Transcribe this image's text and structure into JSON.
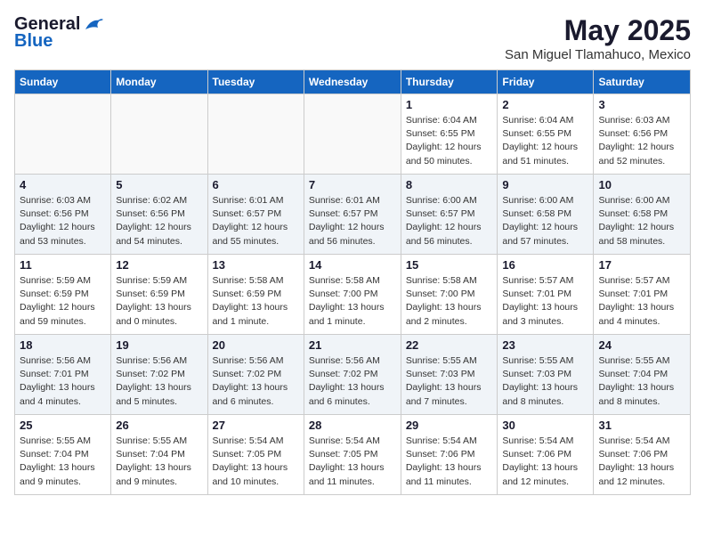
{
  "header": {
    "logo_general": "General",
    "logo_blue": "Blue",
    "month": "May 2025",
    "location": "San Miguel Tlamahuco, Mexico"
  },
  "weekdays": [
    "Sunday",
    "Monday",
    "Tuesday",
    "Wednesday",
    "Thursday",
    "Friday",
    "Saturday"
  ],
  "weeks": [
    [
      {
        "day": "",
        "detail": ""
      },
      {
        "day": "",
        "detail": ""
      },
      {
        "day": "",
        "detail": ""
      },
      {
        "day": "",
        "detail": ""
      },
      {
        "day": "1",
        "detail": "Sunrise: 6:04 AM\nSunset: 6:55 PM\nDaylight: 12 hours\nand 50 minutes."
      },
      {
        "day": "2",
        "detail": "Sunrise: 6:04 AM\nSunset: 6:55 PM\nDaylight: 12 hours\nand 51 minutes."
      },
      {
        "day": "3",
        "detail": "Sunrise: 6:03 AM\nSunset: 6:56 PM\nDaylight: 12 hours\nand 52 minutes."
      }
    ],
    [
      {
        "day": "4",
        "detail": "Sunrise: 6:03 AM\nSunset: 6:56 PM\nDaylight: 12 hours\nand 53 minutes."
      },
      {
        "day": "5",
        "detail": "Sunrise: 6:02 AM\nSunset: 6:56 PM\nDaylight: 12 hours\nand 54 minutes."
      },
      {
        "day": "6",
        "detail": "Sunrise: 6:01 AM\nSunset: 6:57 PM\nDaylight: 12 hours\nand 55 minutes."
      },
      {
        "day": "7",
        "detail": "Sunrise: 6:01 AM\nSunset: 6:57 PM\nDaylight: 12 hours\nand 56 minutes."
      },
      {
        "day": "8",
        "detail": "Sunrise: 6:00 AM\nSunset: 6:57 PM\nDaylight: 12 hours\nand 56 minutes."
      },
      {
        "day": "9",
        "detail": "Sunrise: 6:00 AM\nSunset: 6:58 PM\nDaylight: 12 hours\nand 57 minutes."
      },
      {
        "day": "10",
        "detail": "Sunrise: 6:00 AM\nSunset: 6:58 PM\nDaylight: 12 hours\nand 58 minutes."
      }
    ],
    [
      {
        "day": "11",
        "detail": "Sunrise: 5:59 AM\nSunset: 6:59 PM\nDaylight: 12 hours\nand 59 minutes."
      },
      {
        "day": "12",
        "detail": "Sunrise: 5:59 AM\nSunset: 6:59 PM\nDaylight: 13 hours\nand 0 minutes."
      },
      {
        "day": "13",
        "detail": "Sunrise: 5:58 AM\nSunset: 6:59 PM\nDaylight: 13 hours\nand 1 minute."
      },
      {
        "day": "14",
        "detail": "Sunrise: 5:58 AM\nSunset: 7:00 PM\nDaylight: 13 hours\nand 1 minute."
      },
      {
        "day": "15",
        "detail": "Sunrise: 5:58 AM\nSunset: 7:00 PM\nDaylight: 13 hours\nand 2 minutes."
      },
      {
        "day": "16",
        "detail": "Sunrise: 5:57 AM\nSunset: 7:01 PM\nDaylight: 13 hours\nand 3 minutes."
      },
      {
        "day": "17",
        "detail": "Sunrise: 5:57 AM\nSunset: 7:01 PM\nDaylight: 13 hours\nand 4 minutes."
      }
    ],
    [
      {
        "day": "18",
        "detail": "Sunrise: 5:56 AM\nSunset: 7:01 PM\nDaylight: 13 hours\nand 4 minutes."
      },
      {
        "day": "19",
        "detail": "Sunrise: 5:56 AM\nSunset: 7:02 PM\nDaylight: 13 hours\nand 5 minutes."
      },
      {
        "day": "20",
        "detail": "Sunrise: 5:56 AM\nSunset: 7:02 PM\nDaylight: 13 hours\nand 6 minutes."
      },
      {
        "day": "21",
        "detail": "Sunrise: 5:56 AM\nSunset: 7:02 PM\nDaylight: 13 hours\nand 6 minutes."
      },
      {
        "day": "22",
        "detail": "Sunrise: 5:55 AM\nSunset: 7:03 PM\nDaylight: 13 hours\nand 7 minutes."
      },
      {
        "day": "23",
        "detail": "Sunrise: 5:55 AM\nSunset: 7:03 PM\nDaylight: 13 hours\nand 8 minutes."
      },
      {
        "day": "24",
        "detail": "Sunrise: 5:55 AM\nSunset: 7:04 PM\nDaylight: 13 hours\nand 8 minutes."
      }
    ],
    [
      {
        "day": "25",
        "detail": "Sunrise: 5:55 AM\nSunset: 7:04 PM\nDaylight: 13 hours\nand 9 minutes."
      },
      {
        "day": "26",
        "detail": "Sunrise: 5:55 AM\nSunset: 7:04 PM\nDaylight: 13 hours\nand 9 minutes."
      },
      {
        "day": "27",
        "detail": "Sunrise: 5:54 AM\nSunset: 7:05 PM\nDaylight: 13 hours\nand 10 minutes."
      },
      {
        "day": "28",
        "detail": "Sunrise: 5:54 AM\nSunset: 7:05 PM\nDaylight: 13 hours\nand 11 minutes."
      },
      {
        "day": "29",
        "detail": "Sunrise: 5:54 AM\nSunset: 7:06 PM\nDaylight: 13 hours\nand 11 minutes."
      },
      {
        "day": "30",
        "detail": "Sunrise: 5:54 AM\nSunset: 7:06 PM\nDaylight: 13 hours\nand 12 minutes."
      },
      {
        "day": "31",
        "detail": "Sunrise: 5:54 AM\nSunset: 7:06 PM\nDaylight: 13 hours\nand 12 minutes."
      }
    ]
  ]
}
